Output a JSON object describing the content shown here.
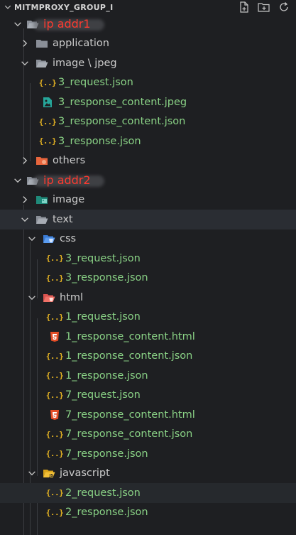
{
  "explorer": {
    "title": "MITMPROXY_GROUP_I"
  },
  "tree": {
    "ip1_label": "ip addr1",
    "application": "application",
    "image_jpeg": "image \\ jpeg",
    "f_3_request": "3_request.json",
    "f_3_response_content_jpeg": "3_response_content.jpeg",
    "f_3_response_content_json": "3_response_content.json",
    "f_3_response": "3_response.json",
    "others": "others",
    "ip2_label": "ip addr2",
    "image": "image",
    "text": "text",
    "css": "css",
    "css_3_request": "3_request.json",
    "css_3_response": "3_response.json",
    "html": "html",
    "h_1_request": "1_request.json",
    "h_1_response_content_html": "1_response_content.html",
    "h_1_response_content_json": "1_response_content.json",
    "h_1_response": "1_response.json",
    "h_7_request": "7_request.json",
    "h_7_response_content_html": "7_response_content.html",
    "h_7_response_content_json": "7_response_content.json",
    "h_7_response": "7_response.json",
    "javascript": "javascript",
    "js_2_request": "2_request.json",
    "js_2_response": "2_response.json"
  },
  "colors": {
    "background": "#1e1f22",
    "file_label": "#89d185",
    "ip_label": "#ff3b30",
    "json_icon": "#e6b422"
  }
}
